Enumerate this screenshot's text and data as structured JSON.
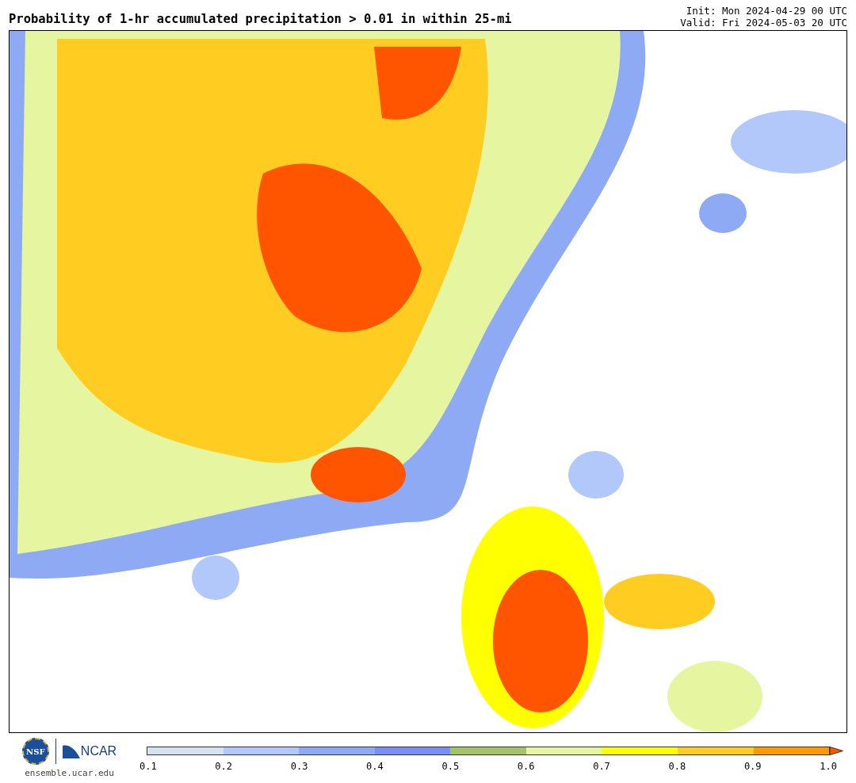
{
  "header": {
    "title": "Probability of 1-hr accumulated precipitation > 0.01 in within 25-mi",
    "init": "Init: Mon 2024-04-29 00 UTC",
    "valid": "Valid: Fri 2024-05-03 20 UTC"
  },
  "footer": {
    "logos": [
      {
        "text": "NSF"
      },
      {
        "text": "NCAR"
      }
    ],
    "site": "ensemble.ucar.edu"
  },
  "colorbar": {
    "segments": [
      {
        "color": "#d5e2f0"
      },
      {
        "color": "#b2c8fa"
      },
      {
        "color": "#8faaf5"
      },
      {
        "color": "#7a8ef5"
      },
      {
        "color": "#a5c46a"
      },
      {
        "color": "#e6f5a0"
      },
      {
        "color": "#ffff00"
      },
      {
        "color": "#ffcc22"
      },
      {
        "color": "#ff9900"
      }
    ],
    "arrow": {
      "color": "#ff5500"
    },
    "ticks": [
      "0.1",
      "0.2",
      "0.3",
      "0.4",
      "0.5",
      "0.6",
      "0.7",
      "0.8",
      "0.9",
      "1.0"
    ]
  }
}
